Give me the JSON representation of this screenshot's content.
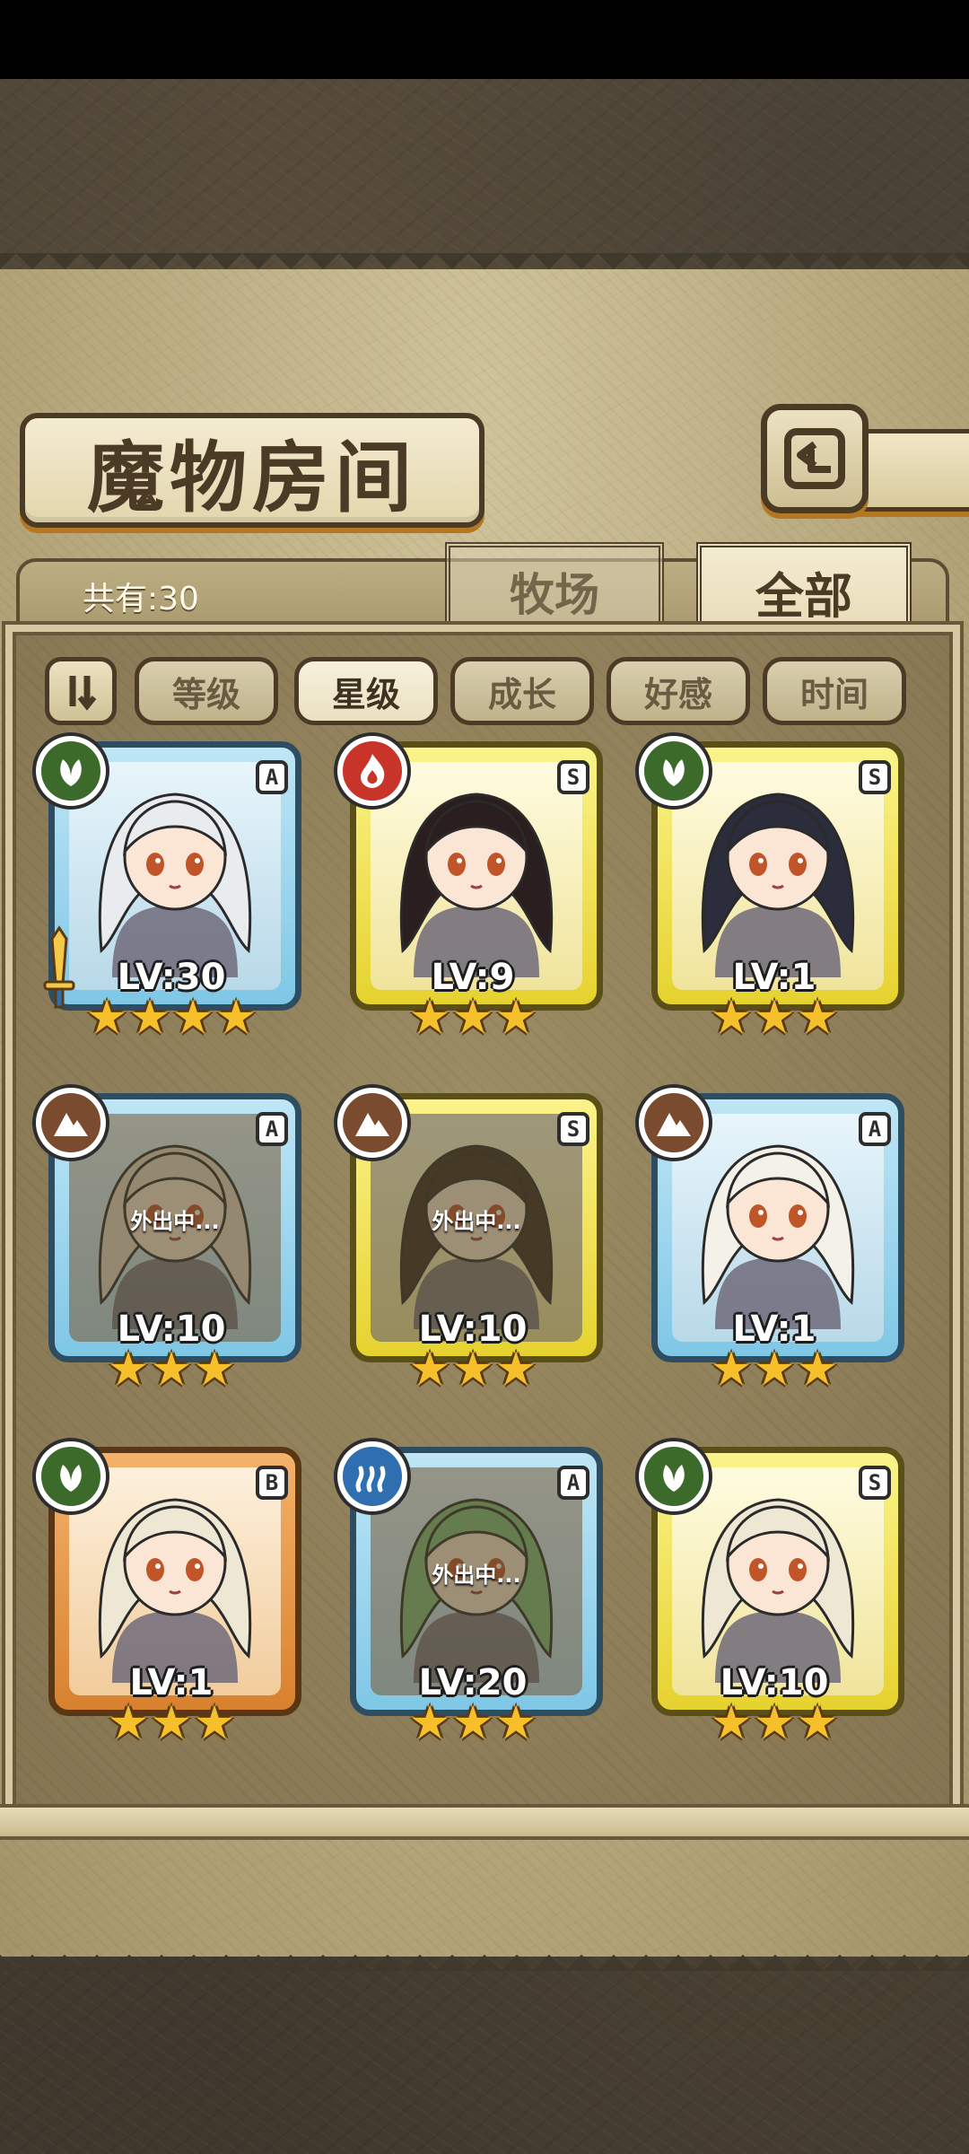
{
  "title": "魔物房间",
  "count_label": "共有:30",
  "tabs": {
    "ranch": "牧场",
    "all": "全部"
  },
  "sort": {
    "toggle": "⇃⇂",
    "buttons": [
      "等级",
      "星级",
      "成长",
      "好感",
      "时间"
    ],
    "active": "星级"
  },
  "out_label": "外出中...",
  "colors": {
    "rarity_A": "#7fc7e6",
    "rarity_S": "#e6d22e",
    "rarity_B": "#d8812f",
    "grass": "#3b6a2b",
    "fire": "#c9342a",
    "earth": "#7a4b2e",
    "water": "#2f6fb0",
    "star": "#f6c02a"
  },
  "monsters": [
    {
      "rank": "A",
      "element": "grass",
      "level": "LV:30",
      "stars": 4,
      "out": false,
      "weapon": true,
      "hair": "#e9ecef"
    },
    {
      "rank": "S",
      "element": "fire",
      "level": "LV:9",
      "stars": 3,
      "out": false,
      "weapon": false,
      "hair": "#2a1e1e"
    },
    {
      "rank": "S",
      "element": "grass",
      "level": "LV:1",
      "stars": 3,
      "out": false,
      "weapon": false,
      "hair": "#2b2d3c"
    },
    {
      "rank": "A",
      "element": "earth",
      "level": "LV:10",
      "stars": 3,
      "out": true,
      "weapon": false,
      "hair": "#e6dcc8"
    },
    {
      "rank": "S",
      "element": "earth",
      "level": "LV:10",
      "stars": 3,
      "out": true,
      "weapon": false,
      "hair": "#3a2a22"
    },
    {
      "rank": "A",
      "element": "earth",
      "level": "LV:1",
      "stars": 3,
      "out": false,
      "weapon": false,
      "hair": "#f4f1e8"
    },
    {
      "rank": "B",
      "element": "grass",
      "level": "LV:1",
      "stars": 3,
      "out": false,
      "weapon": false,
      "hair": "#eee7d3"
    },
    {
      "rank": "A",
      "element": "water",
      "level": "LV:20",
      "stars": 3,
      "out": true,
      "weapon": false,
      "hair": "#7fbf7f"
    },
    {
      "rank": "S",
      "element": "grass",
      "level": "LV:10",
      "stars": 3,
      "out": false,
      "weapon": false,
      "hair": "#eee7d3"
    }
  ]
}
